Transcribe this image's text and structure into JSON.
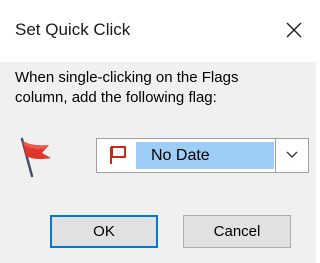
{
  "window": {
    "title": "Set Quick Click",
    "close_icon": "close-icon"
  },
  "message": {
    "line1": "When single-clicking on the Flags",
    "line2": "column, add the following flag:"
  },
  "flag_preview": {
    "icon": "flag-icon",
    "color": "#e0362e"
  },
  "flag_select": {
    "icon": "flag-icon",
    "selected": "No Date",
    "highlight_color": "#9ecdf5",
    "dropdown_icon": "chevron-down-icon"
  },
  "buttons": {
    "ok": "OK",
    "cancel": "Cancel",
    "accent_color": "#0078d7"
  }
}
